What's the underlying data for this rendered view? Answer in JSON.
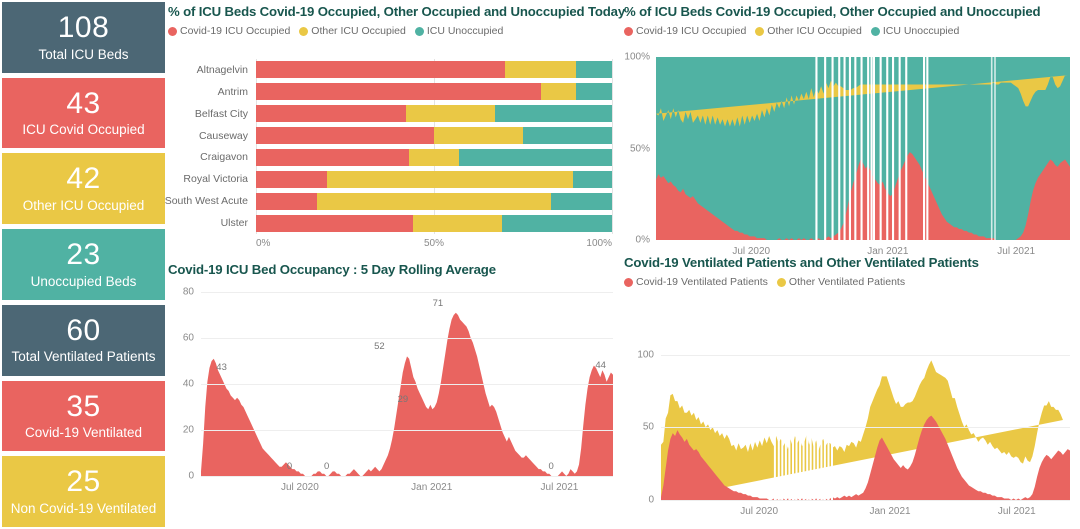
{
  "kpis": [
    {
      "value": "108",
      "label": "Total ICU Beds",
      "color": "#4C6775"
    },
    {
      "value": "43",
      "label": "ICU Covid Occupied",
      "color": "#E96460"
    },
    {
      "value": "42",
      "label": "Other ICU Occupied",
      "color": "#EAC845"
    },
    {
      "value": "23",
      "label": "Unoccupied Beds",
      "color": "#50B2A3"
    },
    {
      "value": "60",
      "label": "Total Ventilated Patients",
      "color": "#4C6775"
    },
    {
      "value": "35",
      "label": "Covid-19 Ventilated",
      "color": "#E96460"
    },
    {
      "value": "25",
      "label": "Non Covid-19 Ventilated",
      "color": "#EAC845"
    }
  ],
  "colors": {
    "covid_red": "#E96460",
    "other_yellow": "#EAC845",
    "unoccupied_teal": "#50B2A3",
    "slate": "#4C6775",
    "title": "#18564E",
    "grid": "#e3e3e3",
    "tick_text": "#8a8a8a"
  },
  "panel_a": {
    "title": "% of ICU Beds Covid-19 Occupied, Other Occupied and Unoccupied Today",
    "legend": [
      {
        "label": "Covid-19 ICU Occupied",
        "color": "#E96460"
      },
      {
        "label": "Other ICU Occupied",
        "color": "#EAC845"
      },
      {
        "label": "ICU Unoccupied",
        "color": "#50B2A3"
      }
    ],
    "chart_data": {
      "type": "bar",
      "orientation": "horizontal",
      "stacked": "percent",
      "title": "% of ICU Beds Covid-19 Occupied, Other Occupied and Unoccupied Today",
      "xlabel": "",
      "ylabel": "",
      "xlim": [
        0,
        100
      ],
      "xticks": [
        "0%",
        "50%",
        "100%"
      ],
      "grid": true,
      "legend_position": "top",
      "categories": [
        "Altnagelvin",
        "Antrim",
        "Belfast City",
        "Causeway",
        "Craigavon",
        "Royal Victoria",
        "South West Acute",
        "Ulster"
      ],
      "series": [
        {
          "name": "Covid-19 ICU Occupied",
          "color": "#E96460",
          "values": [
            70,
            80,
            42,
            50,
            43,
            20,
            17,
            44
          ]
        },
        {
          "name": "Other ICU Occupied",
          "color": "#EAC845",
          "values": [
            20,
            10,
            25,
            25,
            14,
            69,
            66,
            25
          ]
        },
        {
          "name": "ICU Unoccupied",
          "color": "#50B2A3",
          "values": [
            10,
            10,
            33,
            25,
            43,
            11,
            17,
            31
          ]
        }
      ]
    }
  },
  "panel_b": {
    "title": "% of ICU Beds Covid-19 Occupied, Other Occupied and Unoccupied",
    "legend": [
      {
        "label": "Covid-19 ICU Occupied",
        "color": "#E96460"
      },
      {
        "label": "Other ICU Occupied",
        "color": "#EAC845"
      },
      {
        "label": "ICU Unoccupied",
        "color": "#50B2A3"
      }
    ],
    "chart_data": {
      "type": "area",
      "stacked": "percent",
      "title": "% of ICU Beds Covid-19 Occupied, Other Occupied and Unoccupied",
      "xlabel": "",
      "ylabel": "",
      "ylim": [
        0,
        100
      ],
      "yticks": [
        "0%",
        "50%",
        "100%"
      ],
      "xticks": [
        "Jul 2020",
        "Jan 2021",
        "Jul 2021"
      ],
      "grid": false,
      "legend_position": "top",
      "series": [
        {
          "name": "Covid-19 ICU Occupied",
          "color": "#E96460",
          "values": [
            33,
            36,
            34,
            35,
            33,
            31,
            32,
            30,
            29,
            27,
            26,
            28,
            25,
            24,
            23,
            24,
            22,
            20,
            19,
            18,
            17,
            16,
            15,
            14,
            13,
            12,
            11,
            10,
            9,
            8,
            7,
            6,
            5,
            5,
            4,
            4,
            3,
            3,
            2,
            2,
            2,
            1,
            1,
            1,
            1,
            0,
            0,
            0,
            0,
            0,
            1,
            0,
            0,
            1,
            0,
            1,
            0,
            0,
            1,
            0,
            1,
            0,
            0,
            1,
            0,
            0,
            1,
            0,
            0,
            1,
            2,
            1,
            2,
            3,
            4,
            6,
            9,
            14,
            20,
            26,
            31,
            35,
            40,
            44,
            42,
            39,
            41,
            38,
            35,
            33,
            31,
            30,
            32,
            28,
            26,
            24,
            25,
            29,
            33,
            37,
            40,
            43,
            46,
            48,
            47,
            45,
            43,
            41,
            38,
            35,
            32,
            29,
            26,
            23,
            20,
            17,
            14,
            12,
            10,
            9,
            8,
            7,
            7,
            6,
            6,
            5,
            5,
            4,
            4,
            3,
            3,
            2,
            2,
            2,
            1,
            1,
            1,
            1,
            0,
            0,
            0,
            0,
            0,
            0,
            0,
            0,
            0,
            1,
            2,
            4,
            8,
            14,
            21,
            27,
            31,
            34,
            36,
            38,
            40,
            42,
            44,
            43,
            41,
            40,
            42,
            43,
            44,
            42,
            40
          ]
        },
        {
          "name": "Other ICU Occupied",
          "color": "#EAC845",
          "values": [
            36,
            32,
            38,
            30,
            35,
            40,
            34,
            42,
            38,
            44,
            40,
            36,
            45,
            42,
            47,
            40,
            44,
            48,
            45,
            50,
            46,
            52,
            48,
            54,
            50,
            55,
            52,
            56,
            53,
            58,
            55,
            60,
            57,
            62,
            58,
            64,
            60,
            65,
            62,
            66,
            63,
            68,
            64,
            70,
            66,
            72,
            68,
            74,
            70,
            75,
            71,
            76,
            72,
            77,
            73,
            78,
            74,
            79,
            75,
            80,
            76,
            81,
            77,
            82,
            78,
            83,
            79,
            84,
            80,
            85,
            81,
            86,
            82,
            83,
            80,
            78,
            74,
            68,
            62,
            56,
            52,
            48,
            44,
            41,
            43,
            46,
            44,
            47,
            50,
            52,
            54,
            55,
            53,
            57,
            59,
            61,
            60,
            56,
            52,
            48,
            45,
            42,
            39,
            37,
            38,
            40,
            42,
            44,
            47,
            50,
            53,
            56,
            59,
            62,
            65,
            68,
            71,
            73,
            75,
            76,
            77,
            78,
            78,
            79,
            79,
            80,
            80,
            81,
            81,
            82,
            82,
            83,
            83,
            83,
            84,
            84,
            84,
            85,
            85,
            85,
            86,
            86,
            86,
            86,
            86,
            85,
            84,
            82,
            78,
            72,
            65,
            59,
            55,
            52,
            50,
            48,
            46,
            44,
            42,
            43,
            45,
            46,
            44,
            43,
            42,
            44,
            46,
            48
          ]
        }
      ]
    }
  },
  "panel_c": {
    "title": "Covid-19 ICU Bed Occupancy : 5 Day Rolling Average",
    "chart_data": {
      "type": "area",
      "title": "Covid-19 ICU Bed Occupancy : 5 Day Rolling Average",
      "xlabel": "",
      "ylabel": "",
      "ylim": [
        0,
        80
      ],
      "yticks": [
        "0",
        "20",
        "40",
        "60",
        "80"
      ],
      "xticks": [
        "Jul 2020",
        "Jan 2021",
        "Jul 2021"
      ],
      "grid": true,
      "data_labels": [
        {
          "text": "43",
          "x_pct": 5.0,
          "value": 43
        },
        {
          "text": "0",
          "x_pct": 21.5,
          "value": 0
        },
        {
          "text": "0",
          "x_pct": 30.5,
          "value": 0
        },
        {
          "text": "52",
          "x_pct": 43.3,
          "value": 52
        },
        {
          "text": "29",
          "x_pct": 49.0,
          "value": 29
        },
        {
          "text": "71",
          "x_pct": 57.5,
          "value": 71
        },
        {
          "text": "0",
          "x_pct": 85.0,
          "value": 0
        },
        {
          "text": "44",
          "x_pct": 97.0,
          "value": 44
        }
      ],
      "values": [
        2,
        14,
        30,
        41,
        47,
        50,
        51,
        49,
        46,
        44,
        42,
        40,
        38,
        37,
        35,
        34,
        33,
        34,
        33,
        31,
        30,
        28,
        26,
        24,
        22,
        20,
        18,
        16,
        14,
        12,
        11,
        10,
        9,
        8,
        7,
        6,
        5,
        4,
        4,
        5,
        6,
        5,
        4,
        3,
        3,
        2,
        2,
        1,
        1,
        0,
        0,
        0,
        0,
        1,
        1,
        2,
        2,
        1,
        1,
        0,
        0,
        1,
        2,
        2,
        1,
        1,
        0,
        0,
        0,
        1,
        1,
        2,
        3,
        2,
        1,
        0,
        0,
        1,
        2,
        3,
        2,
        3,
        4,
        3,
        2,
        3,
        5,
        7,
        9,
        12,
        16,
        21,
        27,
        33,
        39,
        45,
        49,
        52,
        51,
        47,
        43,
        41,
        38,
        36,
        34,
        32,
        30,
        29,
        31,
        29,
        30,
        32,
        36,
        41,
        47,
        53,
        59,
        64,
        68,
        70,
        71,
        70,
        68,
        67,
        66,
        65,
        63,
        60,
        58,
        55,
        52,
        48,
        44,
        40,
        36,
        33,
        30,
        31,
        30,
        28,
        25,
        22,
        19,
        17,
        15,
        17,
        15,
        13,
        11,
        10,
        9,
        8,
        8,
        9,
        8,
        7,
        6,
        5,
        4,
        3,
        3,
        2,
        2,
        1,
        1,
        0,
        0,
        0,
        0,
        1,
        2,
        1,
        0,
        1,
        3,
        2,
        1,
        2,
        5,
        12,
        22,
        31,
        38,
        43,
        46,
        48,
        47,
        45,
        43,
        46,
        44,
        41,
        43,
        45,
        44
      ]
    }
  },
  "panel_d": {
    "title": "Covid-19 Ventilated Patients and Other Ventilated Patients",
    "legend": [
      {
        "label": "Covid-19 Ventilated Patients",
        "color": "#E96460"
      },
      {
        "label": "Other Ventilated Patients",
        "color": "#EAC845"
      }
    ],
    "chart_data": {
      "type": "area",
      "stacked": true,
      "title": "Covid-19 Ventilated Patients and Other Ventilated Patients",
      "xlabel": "",
      "ylabel": "",
      "ylim": [
        0,
        110
      ],
      "yticks": [
        "0",
        "50",
        "100"
      ],
      "xticks": [
        "Jul 2020",
        "Jan 2021",
        "Jul 2021"
      ],
      "grid": true,
      "legend_position": "top",
      "series": [
        {
          "name": "Covid-19 Ventilated Patients",
          "color": "#E96460",
          "values": [
            2,
            10,
            22,
            34,
            42,
            46,
            44,
            48,
            45,
            43,
            40,
            42,
            38,
            36,
            34,
            35,
            33,
            30,
            28,
            26,
            24,
            22,
            20,
            18,
            16,
            14,
            12,
            10,
            9,
            8,
            7,
            6,
            6,
            5,
            5,
            4,
            4,
            3,
            3,
            2,
            2,
            2,
            1,
            1,
            1,
            1,
            0,
            0,
            1,
            0,
            1,
            0,
            1,
            0,
            1,
            0,
            1,
            0,
            1,
            0,
            1,
            0,
            1,
            0,
            1,
            0,
            1,
            0,
            1,
            0,
            1,
            0,
            1,
            2,
            1,
            2,
            1,
            2,
            3,
            2,
            3,
            2,
            3,
            4,
            3,
            4,
            5,
            8,
            12,
            18,
            24,
            30,
            36,
            41,
            43,
            40,
            37,
            34,
            31,
            28,
            26,
            24,
            22,
            24,
            22,
            21,
            23,
            26,
            31,
            37,
            43,
            48,
            52,
            55,
            57,
            58,
            56,
            54,
            51,
            48,
            45,
            42,
            38,
            34,
            30,
            26,
            22,
            19,
            16,
            14,
            12,
            10,
            9,
            8,
            7,
            6,
            6,
            5,
            5,
            4,
            4,
            3,
            3,
            2,
            2,
            2,
            1,
            1,
            1,
            0,
            1,
            0,
            1,
            0,
            1,
            2,
            1,
            2,
            4,
            9,
            16,
            22,
            26,
            29,
            31,
            30,
            28,
            30,
            32,
            34,
            33,
            31,
            33,
            35,
            34
          ]
        },
        {
          "name": "Other Ventilated Patients",
          "color": "#EAC845",
          "values": [
            36,
            30,
            34,
            26,
            30,
            27,
            24,
            20,
            18,
            22,
            20,
            18,
            24,
            22,
            26,
            20,
            24,
            22,
            26,
            24,
            28,
            26,
            30,
            28,
            32,
            30,
            34,
            32,
            36,
            34,
            30,
            32,
            28,
            34,
            30,
            32,
            34,
            30,
            36,
            32,
            38,
            34,
            40,
            36,
            42,
            38,
            44,
            40,
            36,
            44,
            38,
            42,
            36,
            40,
            34,
            42,
            36,
            44,
            38,
            42,
            36,
            40,
            44,
            38,
            42,
            36,
            40,
            34,
            38,
            42,
            36,
            40,
            38,
            34,
            36,
            32,
            36,
            34,
            30,
            36,
            34,
            38,
            36,
            32,
            38,
            36,
            40,
            42,
            44,
            46,
            44,
            42,
            40,
            38,
            42,
            45,
            48,
            46,
            44,
            42,
            40,
            44,
            42,
            40,
            44,
            46,
            44,
            42,
            40,
            38,
            36,
            34,
            32,
            34,
            36,
            38,
            36,
            34,
            36,
            38,
            40,
            42,
            44,
            42,
            40,
            44,
            42,
            40,
            38,
            36,
            40,
            38,
            36,
            38,
            36,
            34,
            36,
            38,
            36,
            34,
            36,
            34,
            32,
            34,
            32,
            30,
            32,
            30,
            32,
            30,
            28,
            30,
            28,
            26,
            24,
            28,
            26,
            24,
            26,
            28,
            30,
            32,
            34,
            36,
            34,
            38,
            36,
            34,
            30,
            28,
            26,
            24
          ]
        }
      ]
    }
  }
}
